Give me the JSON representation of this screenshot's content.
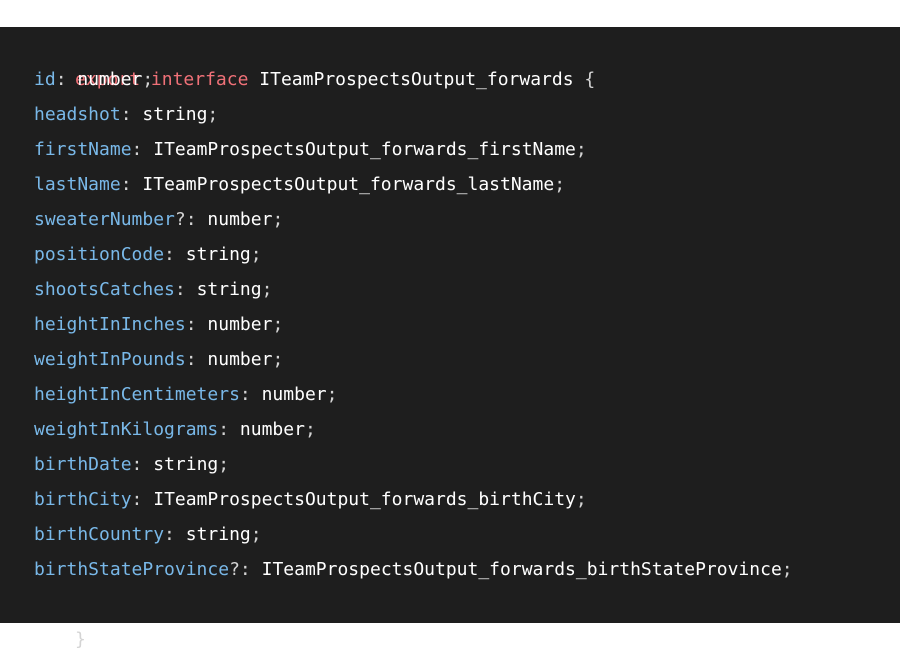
{
  "code": {
    "header": {
      "export_keyword": "export",
      "interface_keyword": "interface",
      "name": "ITeamProspectsOutput_forwards",
      "open_brace": "{"
    },
    "properties": [
      {
        "name": "id",
        "optional": "",
        "type": "number"
      },
      {
        "name": "headshot",
        "optional": "",
        "type": "string"
      },
      {
        "name": "firstName",
        "optional": "",
        "type": "ITeamProspectsOutput_forwards_firstName"
      },
      {
        "name": "lastName",
        "optional": "",
        "type": "ITeamProspectsOutput_forwards_lastName"
      },
      {
        "name": "sweaterNumber",
        "optional": "?",
        "type": "number"
      },
      {
        "name": "positionCode",
        "optional": "",
        "type": "string"
      },
      {
        "name": "shootsCatches",
        "optional": "",
        "type": "string"
      },
      {
        "name": "heightInInches",
        "optional": "",
        "type": "number"
      },
      {
        "name": "weightInPounds",
        "optional": "",
        "type": "number"
      },
      {
        "name": "heightInCentimeters",
        "optional": "",
        "type": "number"
      },
      {
        "name": "weightInKilograms",
        "optional": "",
        "type": "number"
      },
      {
        "name": "birthDate",
        "optional": "",
        "type": "string"
      },
      {
        "name": "birthCity",
        "optional": "",
        "type": "ITeamProspectsOutput_forwards_birthCity"
      },
      {
        "name": "birthCountry",
        "optional": "",
        "type": "string"
      },
      {
        "name": "birthStateProvince",
        "optional": "?",
        "type": "ITeamProspectsOutput_forwards_birthStateProvince"
      }
    ],
    "close_brace": "}"
  },
  "colors": {
    "background": "#1e1e1e",
    "keyword": "#f07178",
    "property": "#79b8e8",
    "text": "#ffffff"
  }
}
